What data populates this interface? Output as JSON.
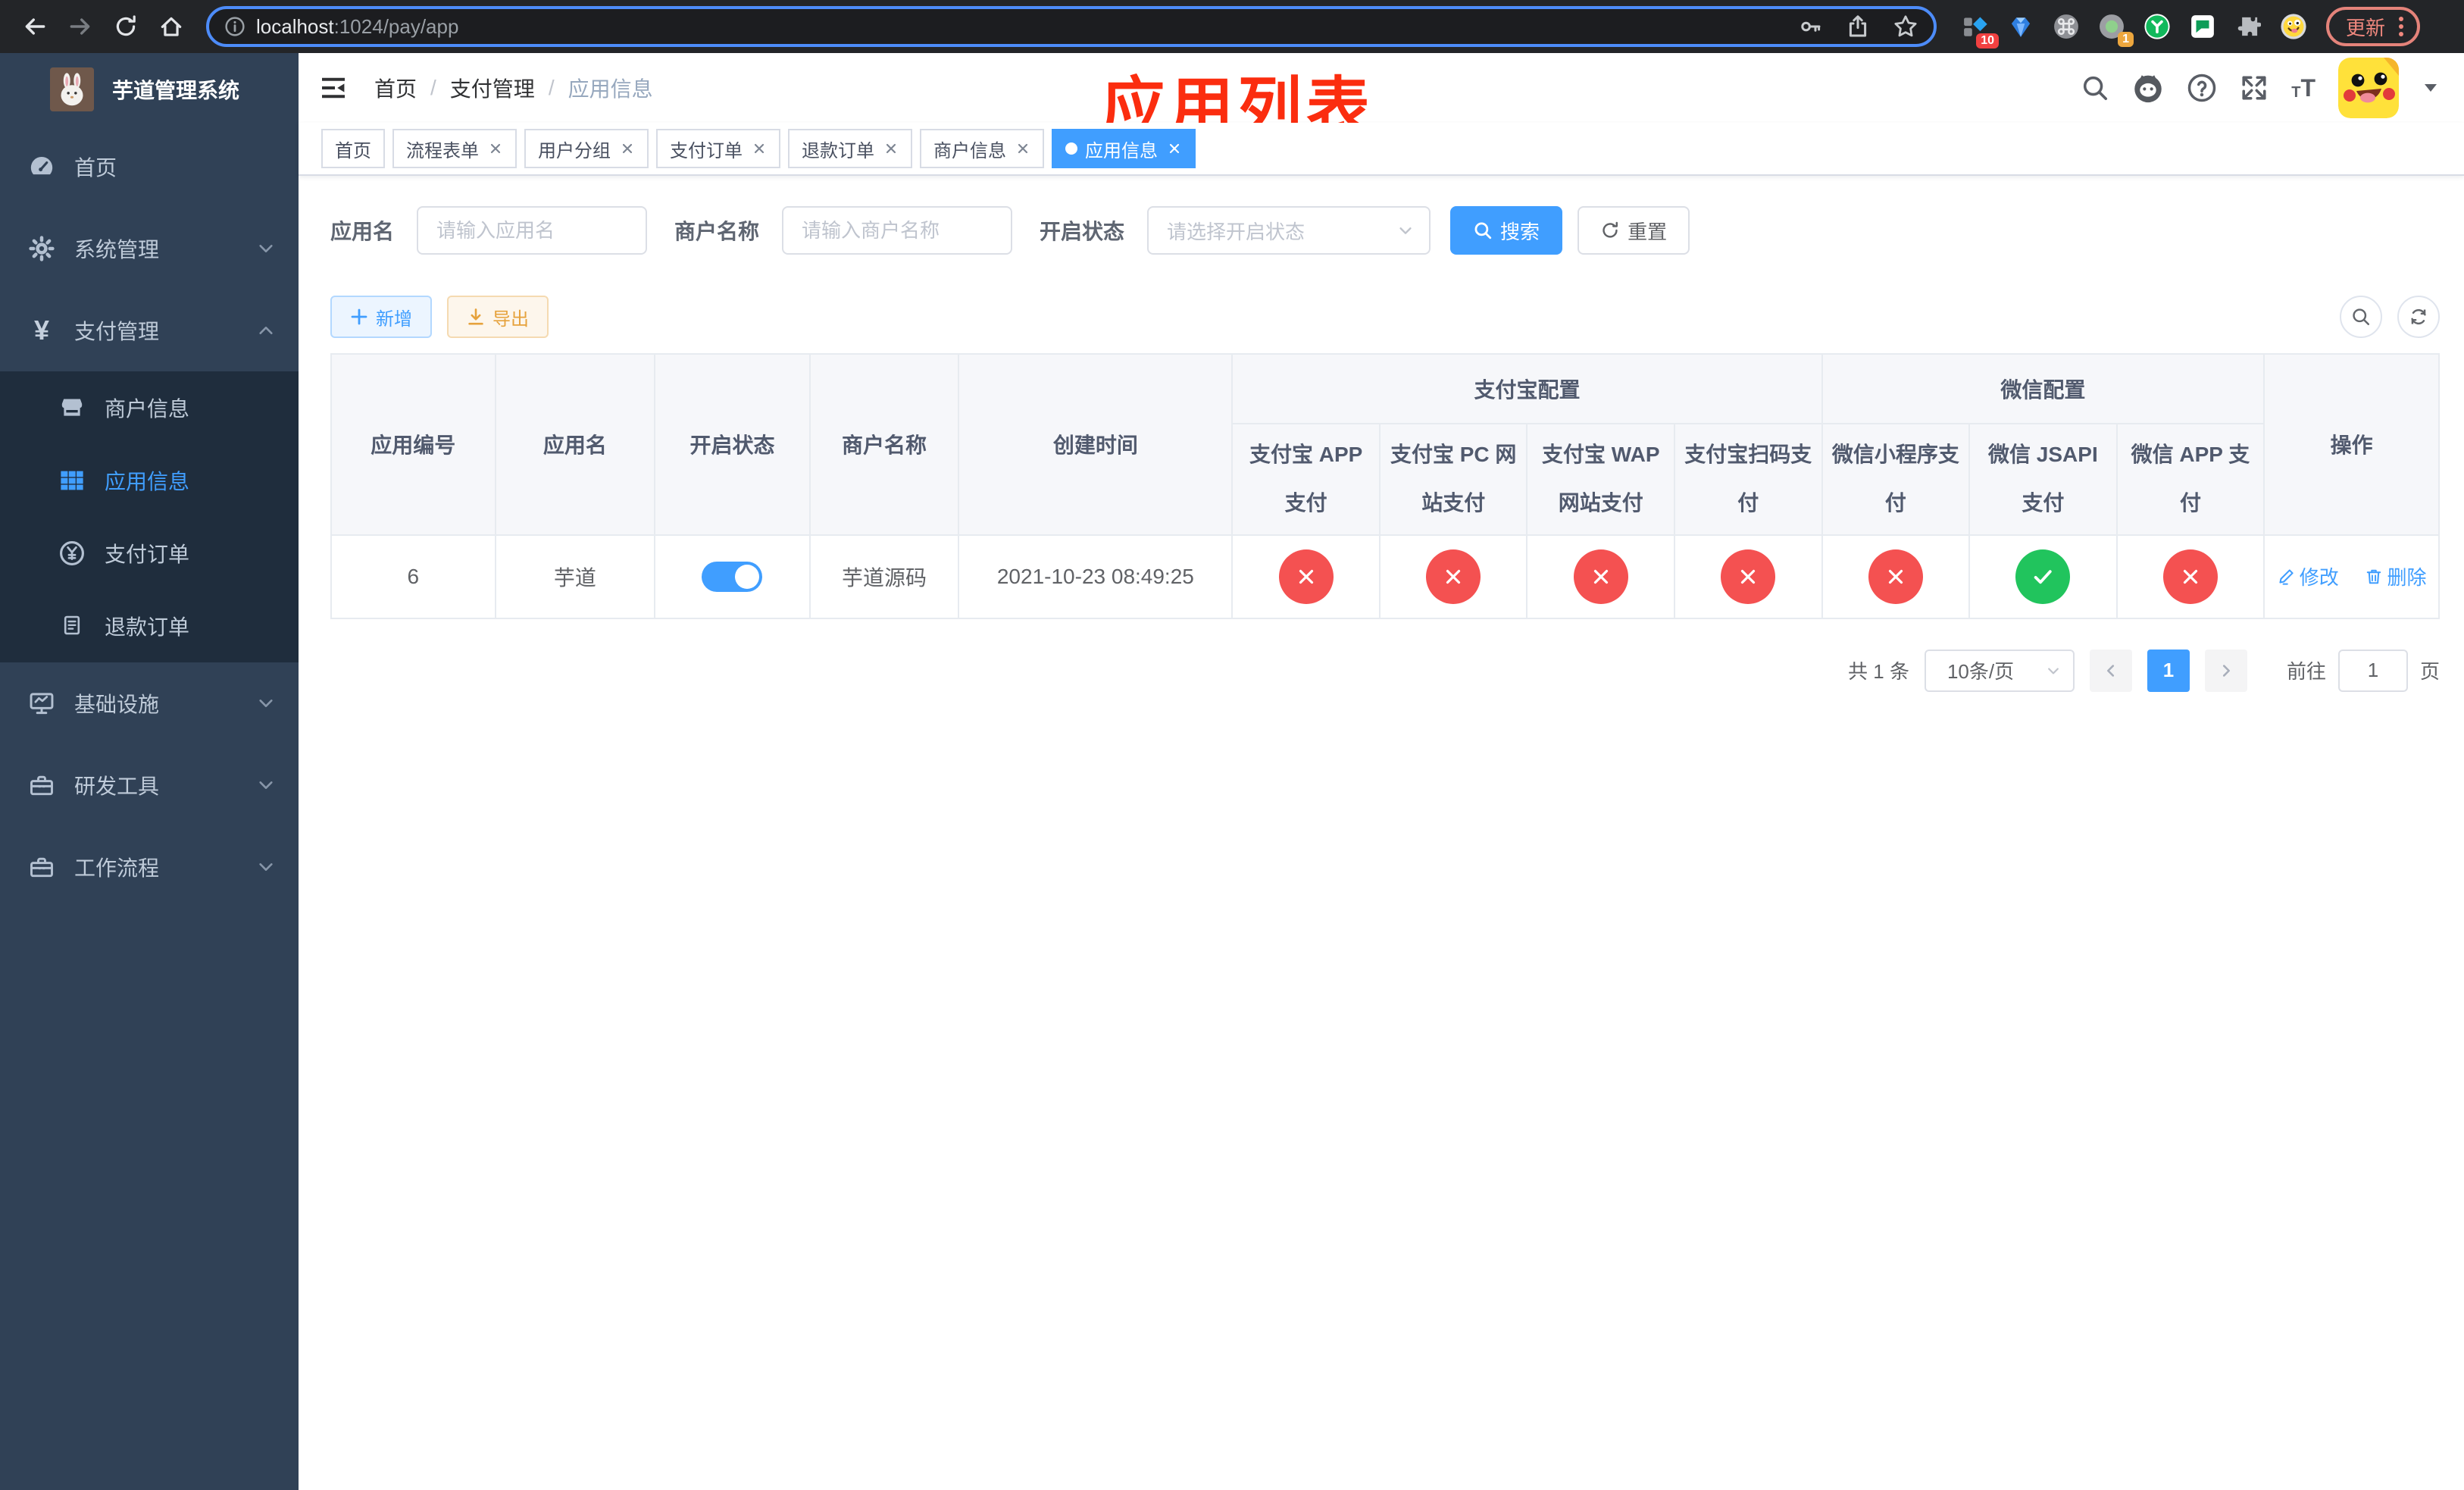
{
  "browser": {
    "url_host": "localhost",
    "url_path": ":1024/pay/app",
    "update_label": "更新",
    "extension_badge_devtools": "10",
    "extension_badge_recorder": "1"
  },
  "sidebar": {
    "title": "芋道管理系统",
    "items": [
      {
        "label": "首页",
        "icon": "dashboard-icon"
      },
      {
        "label": "系统管理",
        "icon": "gear-icon",
        "expandable": true
      },
      {
        "label": "支付管理",
        "icon": "yen-icon",
        "expandable": true,
        "expanded": true,
        "children": [
          {
            "label": "商户信息",
            "icon": "shop-icon"
          },
          {
            "label": "应用信息",
            "icon": "grid-icon",
            "active": true
          },
          {
            "label": "支付订单",
            "icon": "yen-circle-icon"
          },
          {
            "label": "退款订单",
            "icon": "document-icon"
          }
        ]
      },
      {
        "label": "基础设施",
        "icon": "monitor-icon",
        "expandable": true
      },
      {
        "label": "研发工具",
        "icon": "toolbox-icon",
        "expandable": true
      },
      {
        "label": "工作流程",
        "icon": "toolbox-icon",
        "expandable": true
      }
    ]
  },
  "navbar": {
    "breadcrumb": {
      "home": "首页",
      "section": "支付管理",
      "current": "应用信息"
    }
  },
  "annotation": {
    "title": "应用列表"
  },
  "tabs": {
    "items": [
      {
        "label": "首页",
        "closable": false
      },
      {
        "label": "流程表单",
        "closable": true
      },
      {
        "label": "用户分组",
        "closable": true
      },
      {
        "label": "支付订单",
        "closable": true
      },
      {
        "label": "退款订单",
        "closable": true
      },
      {
        "label": "商户信息",
        "closable": true
      },
      {
        "label": "应用信息",
        "closable": true,
        "active": true
      }
    ]
  },
  "filters": {
    "app_name_label": "应用名",
    "app_name_placeholder": "请输入应用名",
    "merchant_label": "商户名称",
    "merchant_placeholder": "请输入商户名称",
    "status_label": "开启状态",
    "status_placeholder": "请选择开启状态",
    "search_label": "搜索",
    "reset_label": "重置"
  },
  "toolbar": {
    "add_label": "新增",
    "export_label": "导出"
  },
  "table": {
    "columns": {
      "id": "应用编号",
      "name": "应用名",
      "enabled": "开启状态",
      "merchant": "商户名称",
      "created": "创建时间",
      "actions": "操作"
    },
    "groups": {
      "alipay": "支付宝配置",
      "wechat": "微信配置"
    },
    "channel_columns": [
      "支付宝 APP 支付",
      "支付宝 PC 网站支付",
      "支付宝 WAP 网站支付",
      "支付宝扫码支付",
      "微信小程序支付",
      "微信 JSAPI 支付",
      "微信 APP 支付"
    ],
    "row": {
      "id": "6",
      "name": "芋道",
      "enabled": true,
      "merchant": "芋道源码",
      "created": "2021-10-23 08:49:25",
      "channels": [
        false,
        false,
        false,
        false,
        false,
        true,
        false
      ]
    },
    "actions": {
      "edit": "修改",
      "delete": "删除"
    }
  },
  "pagination": {
    "total": "共 1 条",
    "page_size": "10条/页",
    "current_page": "1",
    "goto_label": "前往",
    "goto_value": "1",
    "page_unit": "页"
  },
  "colors": {
    "primary": "#409eff",
    "success": "#21c45d",
    "danger": "#f45151",
    "warning": "#e6a23c",
    "sidebar_bg": "#304156",
    "submenu_bg": "#1f2d3d",
    "annotation_red": "#fb2d0f",
    "chrome_bg": "#232528",
    "url_focus_ring": "#4d8cf9",
    "update_chip": "#f0887e"
  },
  "icons": {
    "back-icon": "left arrow",
    "forward-icon": "right arrow",
    "reload-icon": "circular arrow",
    "home-icon": "house",
    "info-icon": "circled i",
    "key-icon": "key",
    "share-icon": "box with up arrow",
    "star-icon": "bookmark star",
    "extensions-icon": "puzzle piece",
    "search-icon": "magnifier",
    "github-icon": "octocat",
    "help-icon": "circled question mark",
    "fullscreen-icon": "expand arrows",
    "font-size-icon": "Tt letters",
    "hamburger-icon": "collapse sidebar lines",
    "edit-icon": "pencil",
    "delete-icon": "trash can",
    "check-icon": "check mark",
    "cross-icon": "x mark"
  }
}
